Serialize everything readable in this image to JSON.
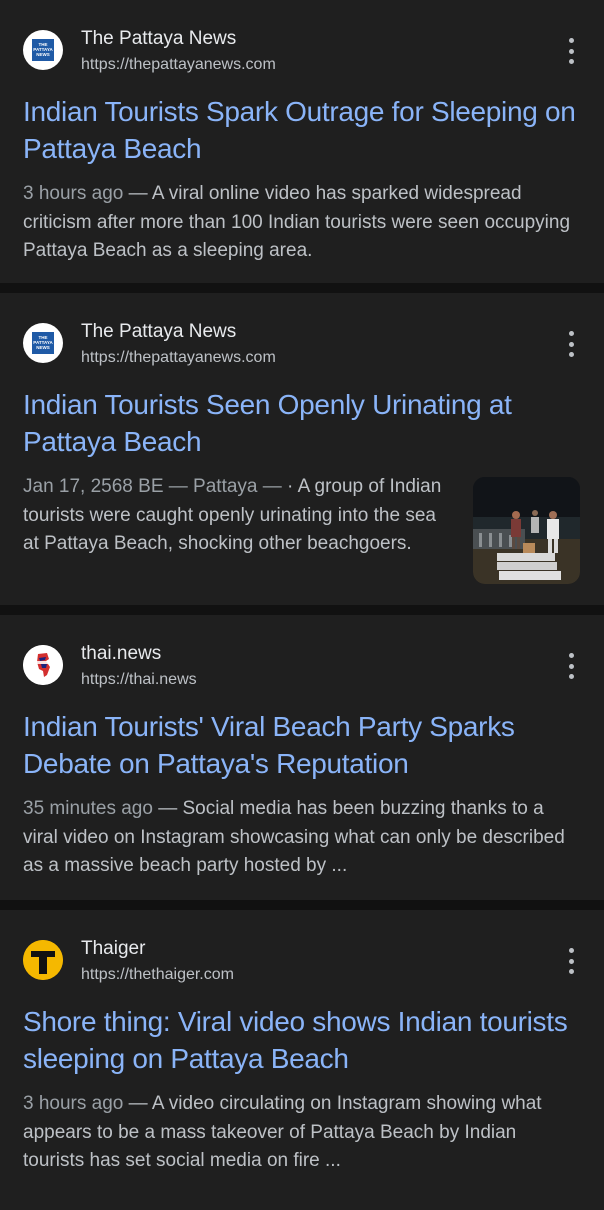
{
  "results": [
    {
      "source_name": "The Pattaya News",
      "source_url": "https://thepattayanews.com",
      "favicon": "the-pattaya-news-logo",
      "logo_text": "THE PATTAYA NEWS",
      "headline": "Indian Tourists Spark Outrage for Sleeping on Pattaya Beach",
      "meta": "3 hours ago",
      "snippet": "A viral online video has sparked widespread criticism after more than 100 Indian tourists were seen occupying Pattaya Beach as a sleeping area."
    },
    {
      "source_name": "The Pattaya News",
      "source_url": "https://thepattayanews.com",
      "favicon": "the-pattaya-news-logo",
      "logo_text": "THE PATTAYA NEWS",
      "headline": "Indian Tourists Seen Openly Urinating at Pattaya Beach",
      "meta": "Jan 17, 2568 BE — Pattaya —",
      "snippet": "· A group of Indian tourists were caught openly urinating into the sea at Pattaya Beach, shocking other beachgoers.",
      "thumbnail": "night-beach-photo"
    },
    {
      "source_name": "thai.news",
      "source_url": "https://thai.news",
      "favicon": "thai-news-logo",
      "headline": "Indian Tourists' Viral Beach Party Sparks Debate on Pattaya's Reputation",
      "meta": "35 minutes ago",
      "snippet": "Social media has been buzzing thanks to a viral video on Instagram showcasing what can only be described as a massive beach party hosted by ..."
    },
    {
      "source_name": "Thaiger",
      "source_url": "https://thethaiger.com",
      "favicon": "thaiger-logo",
      "headline": "Shore thing: Viral video shows Indian tourists sleeping on Pattaya Beach",
      "meta": "3 hours ago",
      "snippet": "A video circulating on Instagram showing what appears to be a mass takeover of Pattaya Beach by Indian tourists has set social media on fire ..."
    }
  ],
  "separator": " — ",
  "colors": {
    "background": "#111111",
    "card": "#1f1f1f",
    "headline": "#8ab4f8",
    "text": "#bdc1c6",
    "thaiger_yellow": "#f5b800"
  }
}
